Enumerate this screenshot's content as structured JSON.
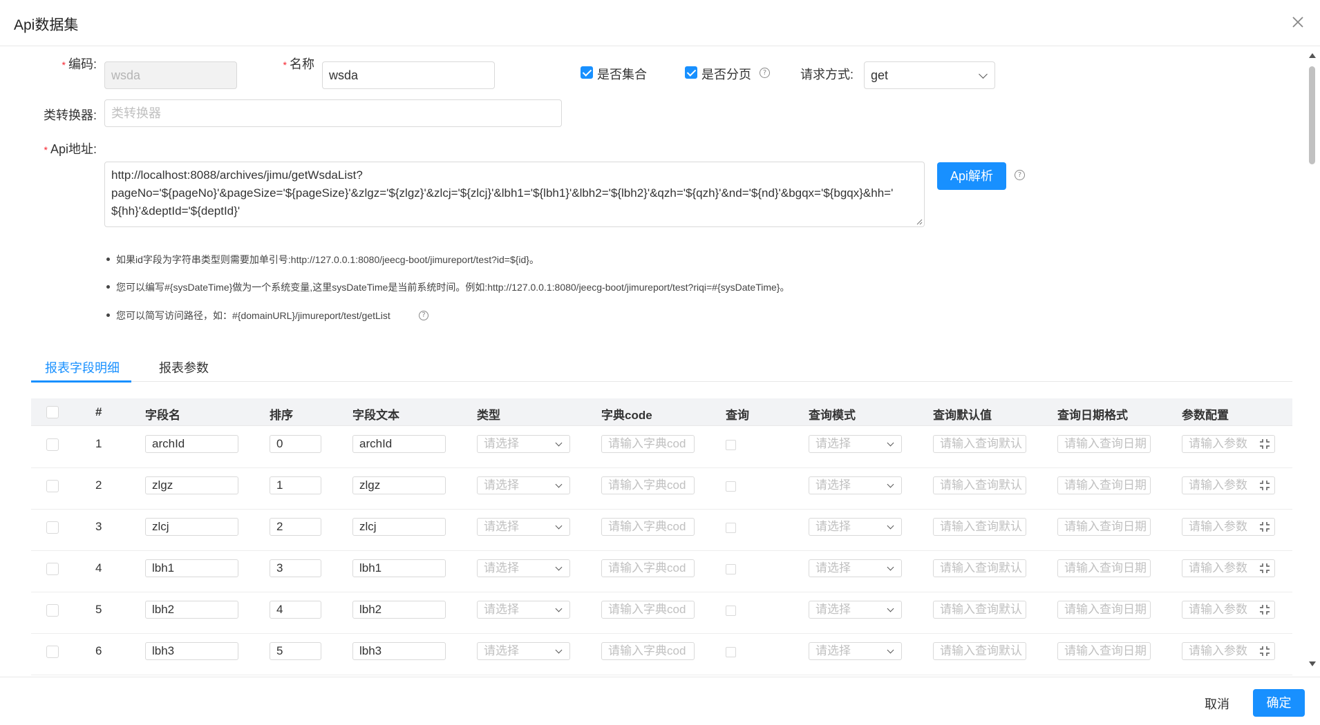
{
  "modal": {
    "title": "Api数据集"
  },
  "form": {
    "code_label": "编码:",
    "code_value": "wsda",
    "name_label": "名称",
    "name_value": "wsda",
    "is_collection_label": "是否集合",
    "is_collection_checked": true,
    "is_paged_label": "是否分页",
    "is_paged_checked": true,
    "request_method_label": "请求方式:",
    "request_method_value": "get",
    "converter_label": "类转换器:",
    "converter_placeholder": "类转换器",
    "api_url_label": "Api地址:",
    "api_url_value": "http://localhost:8088/archives/jimu/getWsdaList?pageNo='${pageNo}'&pageSize='${pageSize}'&zlgz='${zlgz}'&zlcj='${zlcj}'&lbh1='${lbh1}'&lbh2='${lbh2}'&qzh='${qzh}'&nd='${nd}'&bgqx='${bgqx}&hh='${hh}'&deptId='${deptId}'",
    "api_url_line1": "http://localhost:8088/archives/jimu/getWsdaList?",
    "api_url_line2": "pageNo='${pageNo}'&pageSize='${pageSize}'&zlgz='${zlgz}'&zlcj='${zlcj}'&lbh1='${lbh1}'&lbh2='${lbh2}'&qzh='${qzh}'&nd='${nd}'&bgqx='${bgqx}&hh='",
    "api_url_line3": "${hh}'&deptId='${deptId}'",
    "api_parse_button": "Api解析"
  },
  "tips": [
    "如果id字段为字符串类型则需要加单引号:http://127.0.0.1:8080/jeecg-boot/jimureport/test?id=${id}。",
    "您可以编写#{sysDateTime}做为一个系统变量,这里sysDateTime是当前系统时间。例如:http://127.0.0.1:8080/jeecg-boot/jimureport/test?riqi=#{sysDateTime}。",
    "您可以简写访问路径，如：#{domainURL}/jimureport/test/getList"
  ],
  "tabs": [
    {
      "label": "报表字段明细",
      "active": true
    },
    {
      "label": "报表参数",
      "active": false
    }
  ],
  "table": {
    "columns": [
      "#",
      "字段名",
      "排序",
      "字段文本",
      "类型",
      "字典code",
      "查询",
      "查询模式",
      "查询默认值",
      "查询日期格式",
      "参数配置"
    ],
    "placeholders": {
      "type": "请选择",
      "dict_code": "请输入字典cod",
      "query_mode": "请选择",
      "query_default": "请输入查询默认",
      "query_date_format": "请输入查询日期",
      "param_config": "请输入参数"
    },
    "rows": [
      {
        "num": "1",
        "field_name": "archId",
        "order": "0",
        "field_text": "archId"
      },
      {
        "num": "2",
        "field_name": "zlgz",
        "order": "1",
        "field_text": "zlgz"
      },
      {
        "num": "3",
        "field_name": "zlcj",
        "order": "2",
        "field_text": "zlcj"
      },
      {
        "num": "4",
        "field_name": "lbh1",
        "order": "3",
        "field_text": "lbh1"
      },
      {
        "num": "5",
        "field_name": "lbh2",
        "order": "4",
        "field_text": "lbh2"
      },
      {
        "num": "6",
        "field_name": "lbh3",
        "order": "5",
        "field_text": "lbh3"
      }
    ]
  },
  "footer": {
    "cancel_label": "取消",
    "confirm_label": "确定"
  },
  "colors": {
    "primary": "#1890ff",
    "required": "#f5222d"
  },
  "icons": {
    "close": "close-icon",
    "help": "question-circle-icon",
    "dropdown": "chevron-down-icon",
    "expand": "expand-icon"
  }
}
